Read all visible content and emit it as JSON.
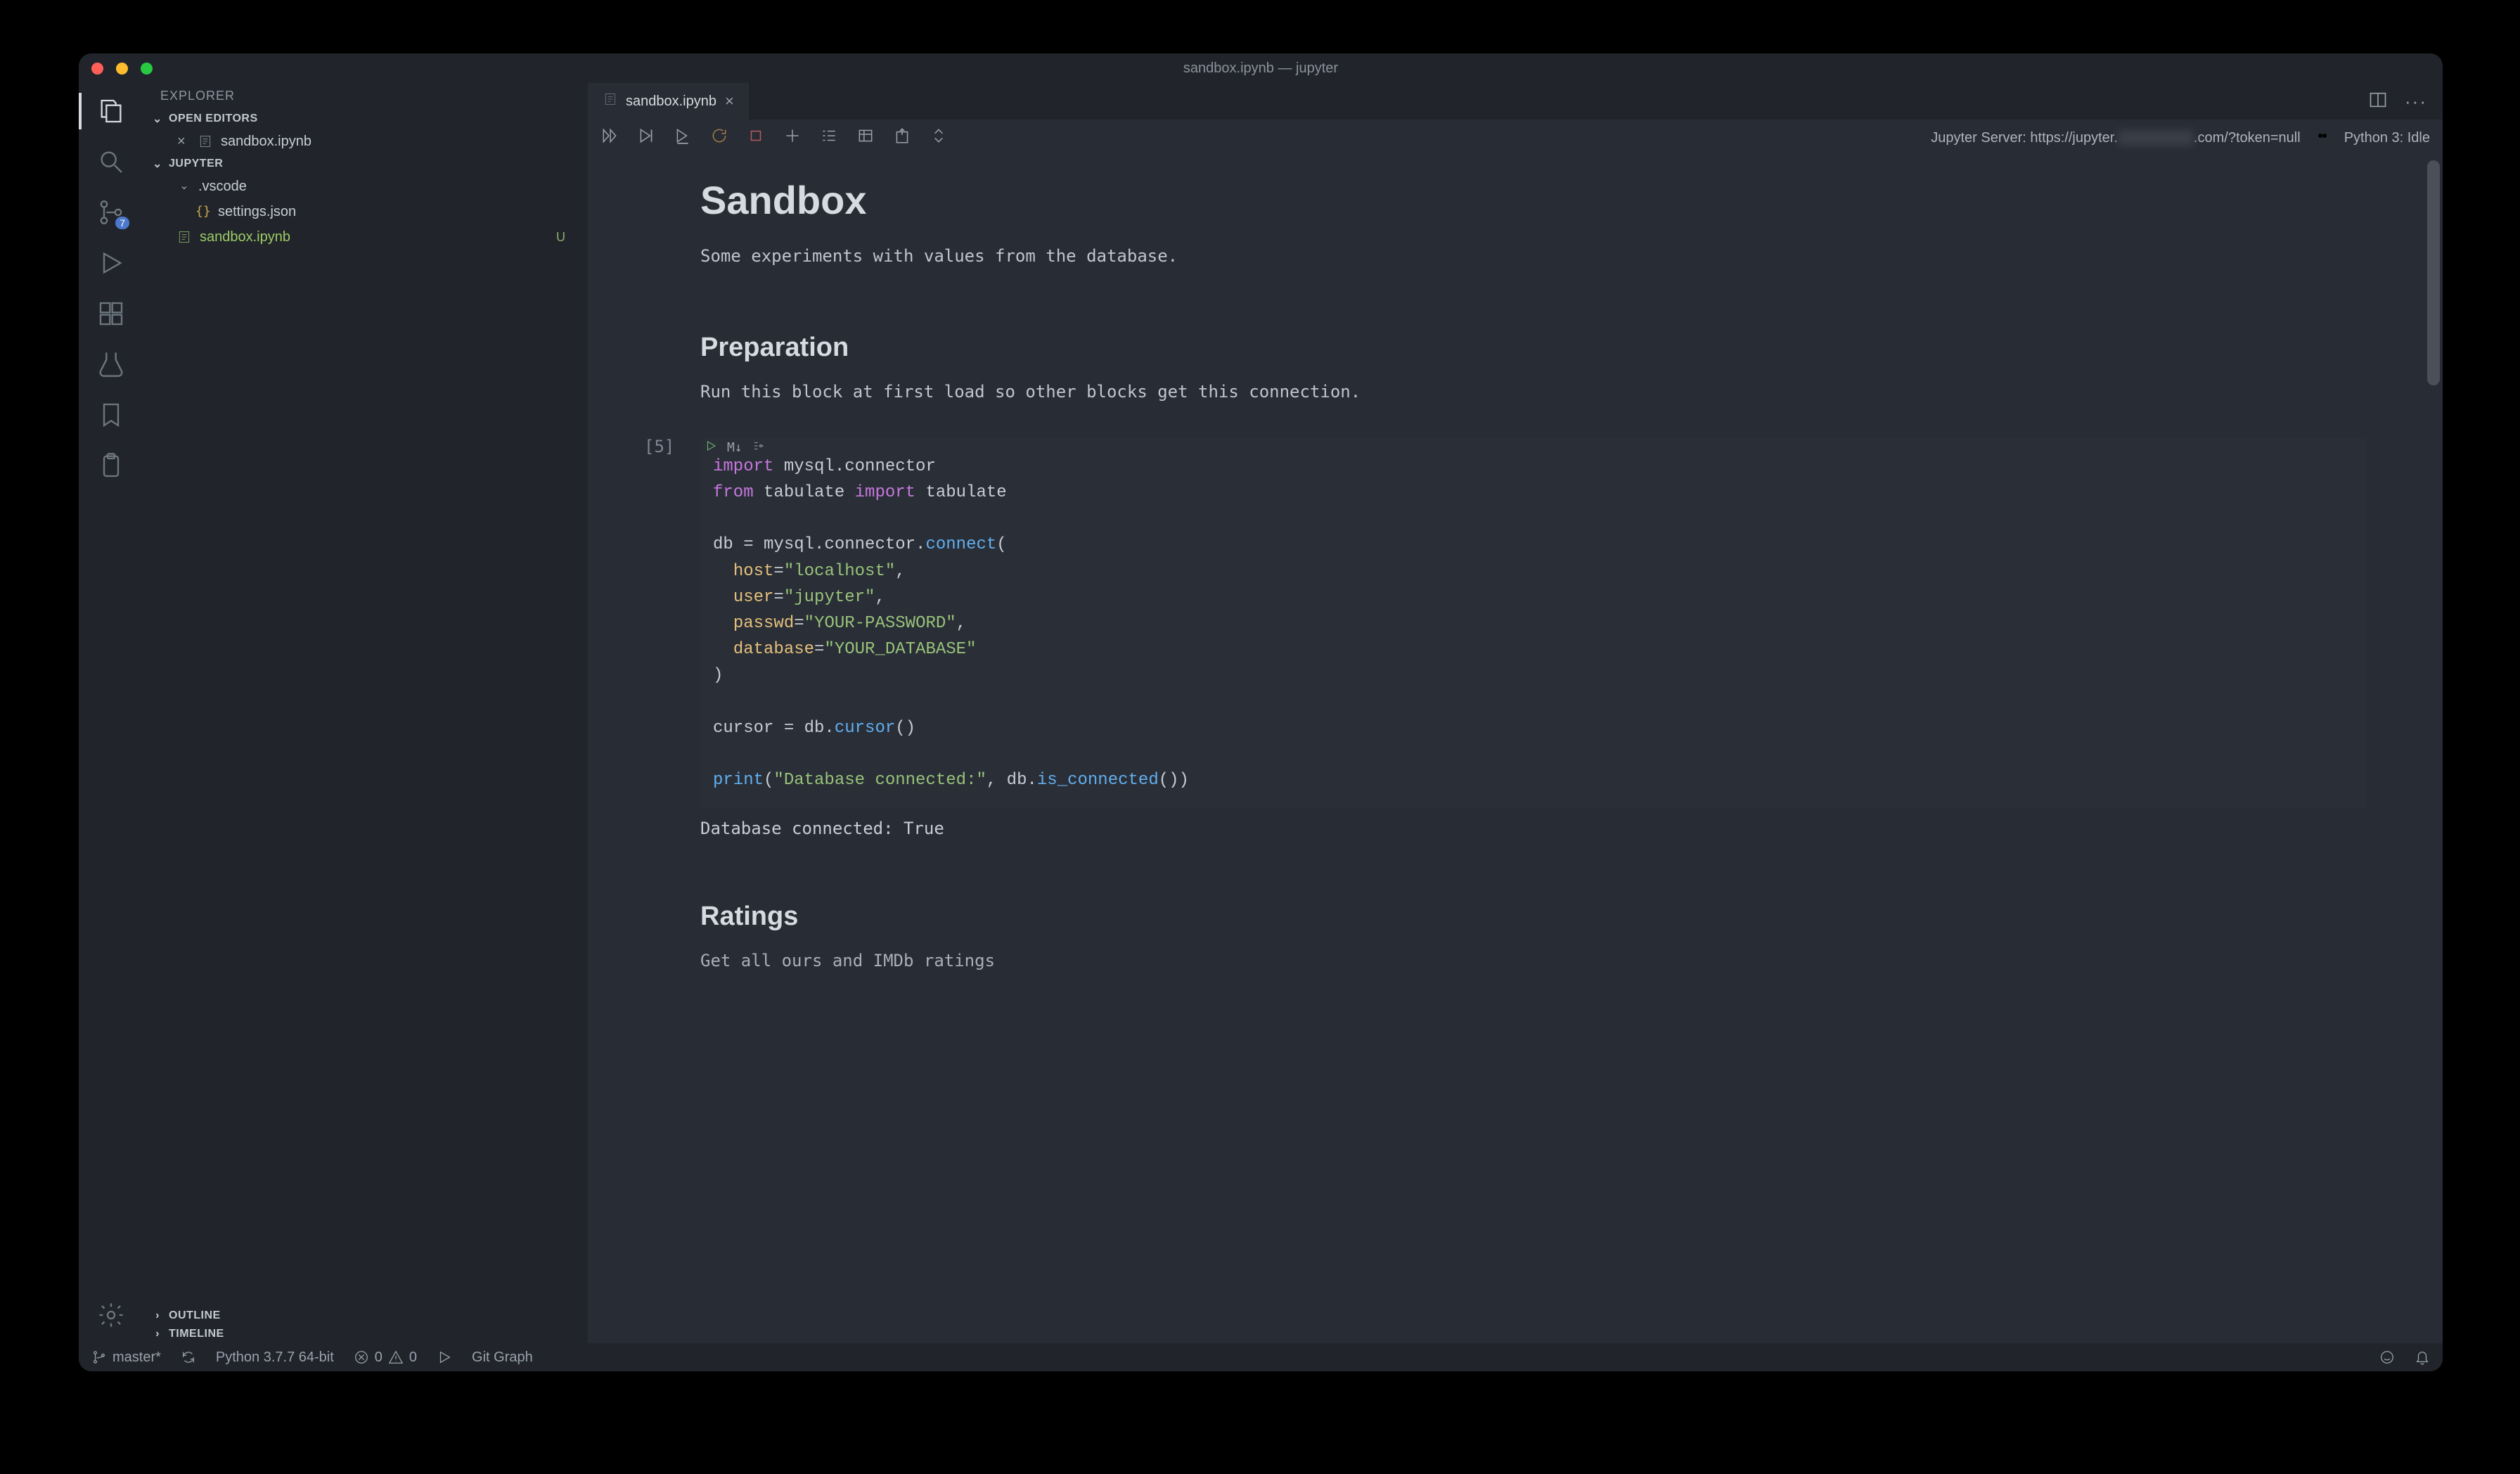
{
  "window": {
    "title": "sandbox.ipynb — jupyter"
  },
  "sidebar": {
    "title": "EXPLORER",
    "open_editors_label": "OPEN EDITORS",
    "workspace_label": "JUPYTER",
    "outline_label": "OUTLINE",
    "timeline_label": "TIMELINE",
    "open_editor_item": "sandbox.ipynb",
    "folder_vscode": ".vscode",
    "file_settings": "settings.json",
    "file_sandbox": "sandbox.ipynb",
    "status_u": "U",
    "scm_badge": "7"
  },
  "tab": {
    "label": "sandbox.ipynb"
  },
  "nb_toolbar": {
    "server_label": "Jupyter Server: https://jupyter.",
    "server_suffix": ".com/?token=null",
    "kernel_label": "Python 3: Idle"
  },
  "notebook": {
    "h1": "Sandbox",
    "intro": "Some experiments with values from the database.",
    "h2_prep": "Preparation",
    "prep_p": "Run this block at first load so other blocks get this connection.",
    "exec_count": "[5]",
    "code_line1_kw_import": "import",
    "code_line1_rest": " mysql.connector",
    "code_line2_kw_from": "from",
    "code_line2_mid": " tabulate ",
    "code_line2_kw_import": "import",
    "code_line2_rest": " tabulate",
    "code_line4_pre": "db = mysql.connector.",
    "code_line4_fn": "connect",
    "code_line4_post": "(",
    "code_line5_arg": "host",
    "code_line5_eq": "=",
    "code_line5_str": "\"localhost\"",
    "code_line5_post": ",",
    "code_line6_arg": "user",
    "code_line6_str": "\"jupyter\"",
    "code_line7_arg": "passwd",
    "code_line7_str": "\"YOUR-PASSWORD\"",
    "code_line8_arg": "database",
    "code_line8_str": "\"YOUR_DATABASE\"",
    "code_line9": ")",
    "code_line11_pre": "cursor = db.",
    "code_line11_fn": "cursor",
    "code_line11_post": "()",
    "code_line13_fn": "print",
    "code_line13_open": "(",
    "code_line13_str": "\"Database connected:\"",
    "code_line13_mid": ", db.",
    "code_line13_fn2": "is_connected",
    "code_line13_post": "())",
    "cell_output": "Database connected: True",
    "h2_ratings": "Ratings",
    "ratings_p": "Get all ours and IMDb ratings"
  },
  "statusbar": {
    "branch": "master*",
    "python": "Python 3.7.7 64-bit",
    "errors": "0",
    "warnings": "0",
    "gitgraph": "Git Graph"
  }
}
